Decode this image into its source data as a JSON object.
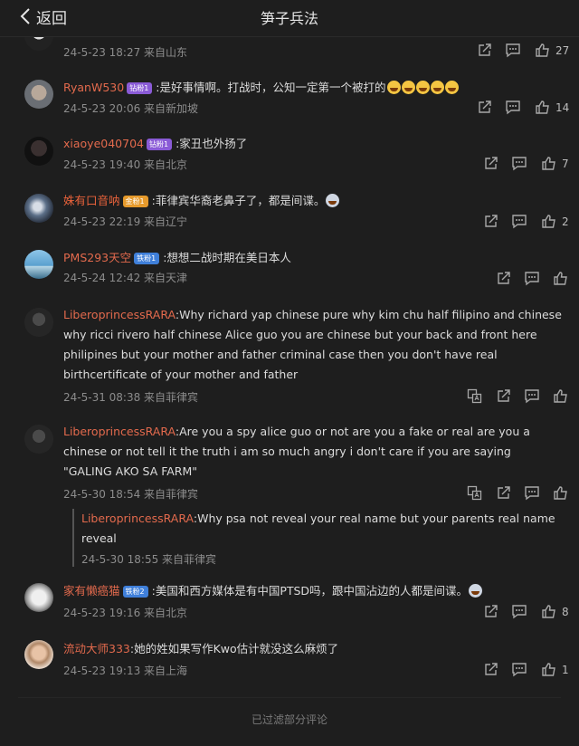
{
  "header": {
    "back_label": "返回",
    "title": "笋子兵法"
  },
  "comments": [
    {
      "meta": "24-5-23 18:27 来自山东",
      "likes": "27"
    },
    {
      "user": "RyanW530",
      "badge": "钻粉1",
      "text": ":是好事情啊。打战时，公知一定第一个被打的",
      "meta": "24-5-23 20:06 来自新加坡",
      "likes": "14"
    },
    {
      "user": "xiaoye040704",
      "badge": "钻粉1",
      "text": ":家丑也外扬了",
      "meta": "24-5-23 19:40 来自北京",
      "likes": "7"
    },
    {
      "user": "姝有口音呐",
      "badge": "金粉1",
      "text": ":菲律宾华裔老鼻子了，都是间谍。",
      "meta": "24-5-23 22:19 来自辽宁",
      "likes": "2"
    },
    {
      "user": "PMS293天空",
      "badge": "铁粉1",
      "text": ":想想二战时期在美日本人",
      "meta": "24-5-24 12:42 来自天津",
      "likes": ""
    },
    {
      "user": "LiberoprincessRARA",
      "text": ":Why richard yap chinese pure why kim chu half filipino and chinese why ricci rivero half chinese Alice guo you are chinese but your back and front here philipines but your mother and father criminal case then you don't have real birthcertificate of your mother and father",
      "meta": "24-5-31 08:38 来自菲律宾",
      "likes": ""
    },
    {
      "user": "LiberoprincessRARA",
      "text": ":Are you a spy alice guo or not are you a fake or real are you a chinese or not tell it the truth i am so much angry i don't care if you are saying \"GALING AKO SA FARM\"",
      "meta": "24-5-30 18:54 来自菲律宾",
      "likes": ""
    },
    {
      "user": "家有懒癌猫",
      "badge": "铁粉2",
      "text": ":美国和西方媒体是有中国PTSD吗，跟中国沾边的人都是间谍。",
      "meta": "24-5-23 19:16 来自北京",
      "likes": "8"
    },
    {
      "user": "流动大师333",
      "text": ":她的姓如果写作Kwo估计就没这么麻烦了",
      "meta": "24-5-23 19:13 来自上海",
      "likes": "1"
    }
  ],
  "reply": {
    "user": "LiberoprincessRARA",
    "text": ":Why psa not reveal your real name but your parents real name reveal",
    "meta": "24-5-30 18:55 来自菲律宾"
  },
  "footer": "已过滤部分评论",
  "colors": {
    "background": "#1e1e1e",
    "username": "#e36a4d",
    "meta": "#8c8c8c"
  }
}
